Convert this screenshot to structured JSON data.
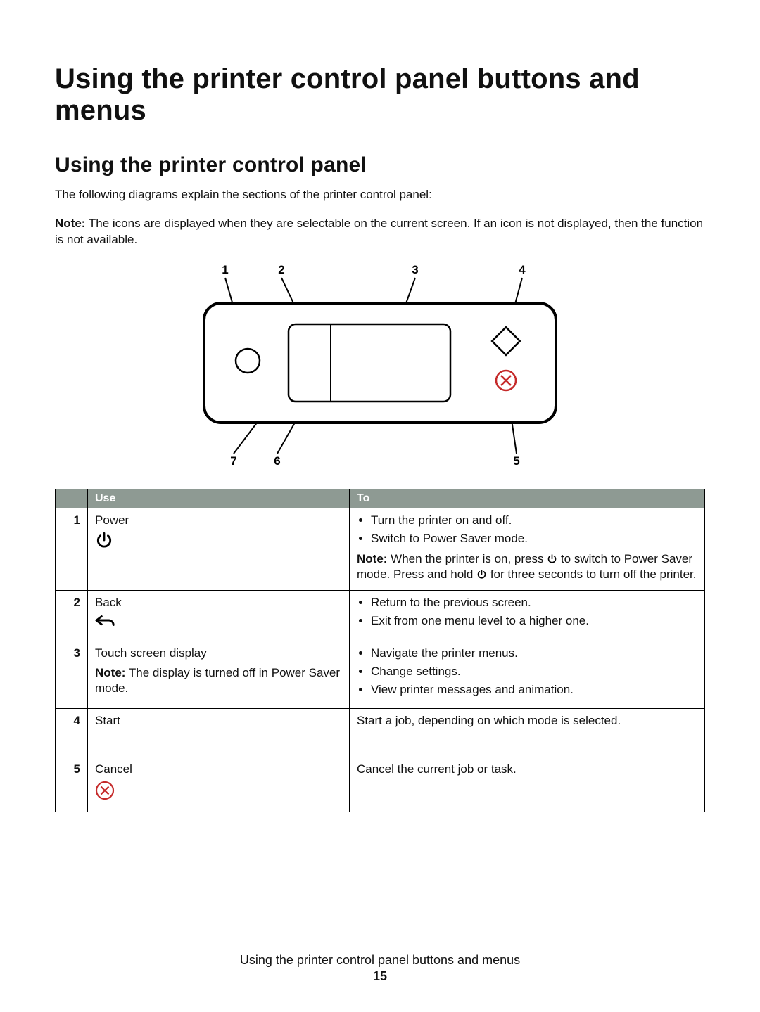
{
  "heading1": "Using the printer control panel buttons and menus",
  "heading2": "Using the printer control panel",
  "intro": "The following diagrams explain the sections of the printer control panel:",
  "note_label": "Note:",
  "note_body": " The icons are displayed when they are selectable on the current screen. If an icon is not displayed, then the function is not available.",
  "diagram": {
    "callouts": {
      "top": [
        "1",
        "2",
        "3",
        "4"
      ],
      "bottom_left": [
        "7",
        "6"
      ],
      "bottom_right": "5"
    }
  },
  "table": {
    "headers": {
      "num": "",
      "use": "Use",
      "to": "To"
    },
    "rows": [
      {
        "num": "1",
        "use": "Power",
        "bullets": [
          "Turn the printer on and off.",
          "Switch to Power Saver mode."
        ],
        "note_parts": {
          "a": " When the printer is on, press ",
          "b": " to switch to Power Saver mode. Press and hold ",
          "c": " for three seconds to turn off the printer."
        }
      },
      {
        "num": "2",
        "use": "Back",
        "bullets": [
          "Return to the previous screen.",
          "Exit from one menu level to a higher one."
        ]
      },
      {
        "num": "3",
        "use": "Touch screen display",
        "use_note": " The display is turned off in Power Saver mode.",
        "bullets": [
          "Navigate the printer menus.",
          "Change settings.",
          "View printer messages and animation."
        ]
      },
      {
        "num": "4",
        "use": "Start",
        "plain": "Start a job, depending on which mode is selected."
      },
      {
        "num": "5",
        "use": "Cancel",
        "plain": "Cancel the current job or task."
      }
    ]
  },
  "footer": {
    "title": "Using the printer control panel buttons and menus",
    "page": "15"
  }
}
